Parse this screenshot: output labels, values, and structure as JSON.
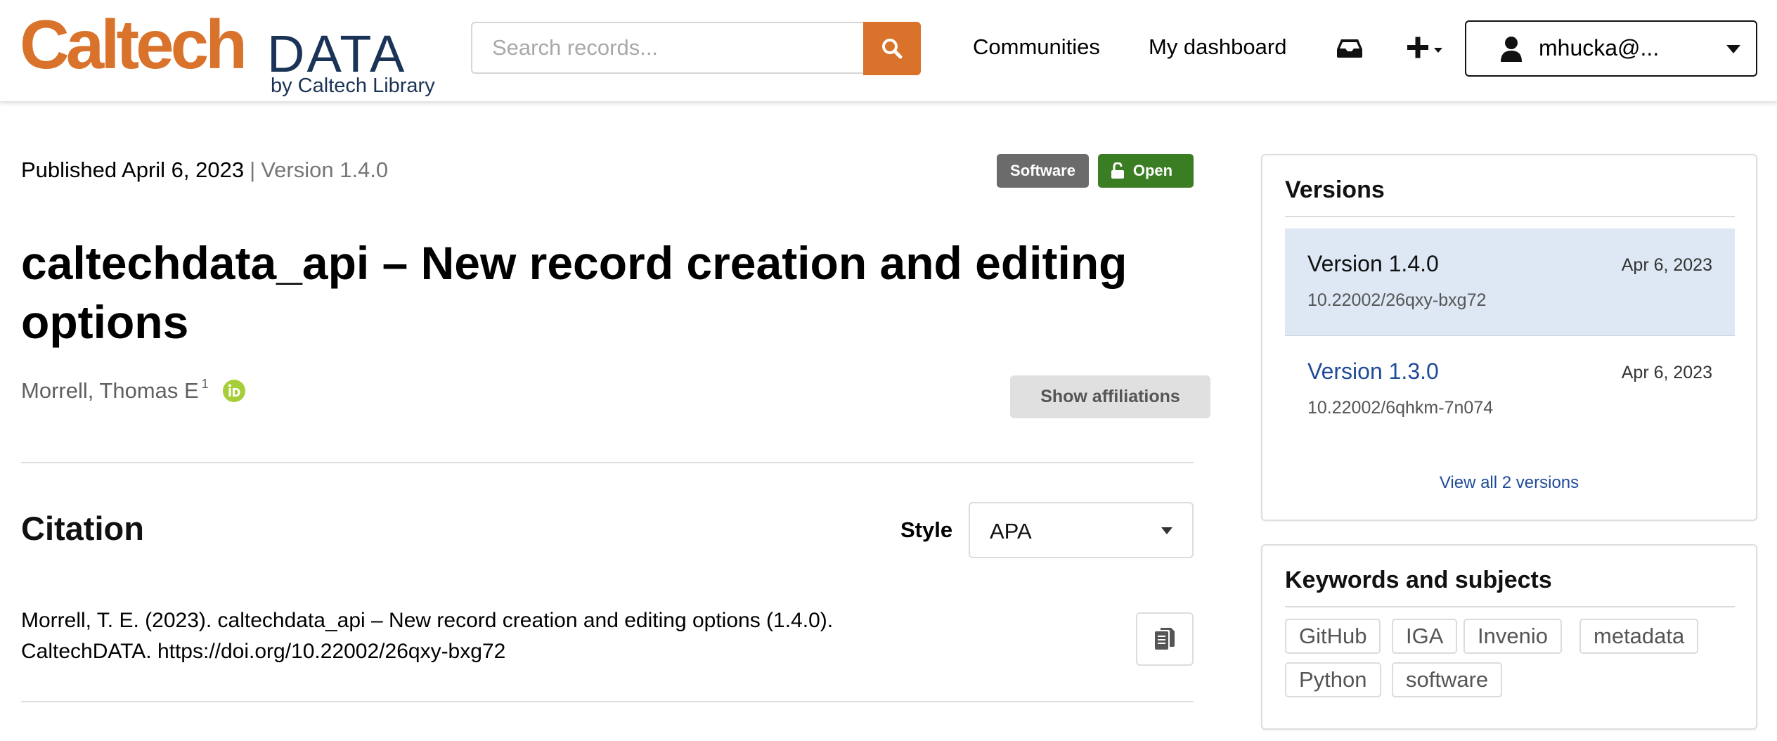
{
  "colors": {
    "brand_orange": "#d9722a",
    "brand_navy": "#1b3356",
    "badge_software": "#6b6b6b",
    "badge_open": "#3a7d23",
    "link_blue": "#1f4b9a",
    "orcid_green": "#a6ce39",
    "button_grey": "#e0e0e0",
    "button_grey_text": "#555555"
  },
  "header": {
    "logo": {
      "caltech": "Caltech",
      "data": "DATA",
      "byline": "by Caltech Library"
    },
    "search": {
      "placeholder": "Search records...",
      "value": "",
      "button_icon": "search-icon"
    },
    "nav": {
      "communities": "Communities",
      "dashboard": "My dashboard"
    },
    "inbox_icon": "inbox-icon",
    "create_icon": "plus-icon",
    "user": {
      "name": "mhucka@...",
      "icon": "user-icon"
    }
  },
  "record": {
    "published": "Published April 6, 2023",
    "separator": "|",
    "version": "Version 1.4.0",
    "badges": {
      "type": "Software",
      "access": "Open"
    },
    "title": "caltechdata_api – New record creation and editing options",
    "author": {
      "name": "Morrell, Thomas E",
      "affiliation_marker": "1",
      "orcid_icon": "orcid-icon"
    },
    "show_affiliations": "Show affiliations"
  },
  "citation": {
    "heading": "Citation",
    "style_label": "Style",
    "style_value": "APA",
    "text": "Morrell, T. E. (2023). caltechdata_api – New record creation and editing options (1.4.0). CaltechDATA. https://doi.org/10.22002/26qxy-bxg72",
    "copy_icon": "copy-icon"
  },
  "versions": {
    "heading": "Versions",
    "items": [
      {
        "name": "Version 1.4.0",
        "date": "Apr 6, 2023",
        "doi": "10.22002/26qxy-bxg72",
        "active": true
      },
      {
        "name": "Version 1.3.0",
        "date": "Apr 6, 2023",
        "doi": "10.22002/6qhkm-7n074",
        "active": false
      }
    ],
    "view_all": "View all 2 versions"
  },
  "keywords": {
    "heading": "Keywords and subjects",
    "items": [
      "GitHub",
      "IGA",
      "Invenio",
      "metadata",
      "Python",
      "software"
    ]
  }
}
